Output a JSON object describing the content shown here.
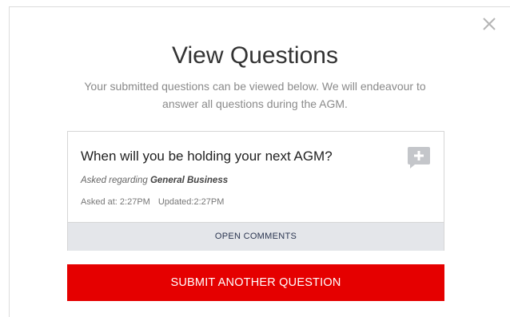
{
  "modal": {
    "title": "View Questions",
    "subtitle": "Your submitted questions can be viewed below. We will endeavour to answer all questions during the AGM."
  },
  "question": {
    "text": "When will you be holding your next AGM?",
    "regarding_prefix": "Asked regarding",
    "regarding_topic": "General Business",
    "asked_at": "Asked at: 2:27PM",
    "updated_at": "Updated:2:27PM",
    "open_comments_label": "OPEN COMMENTS"
  },
  "actions": {
    "submit_another_label": "SUBMIT ANOTHER QUESTION"
  },
  "colors": {
    "accent_red": "#e50000",
    "comments_bar": "#e4e6ea",
    "comment_icon": "#c4c6ca"
  },
  "icons": {
    "close": "close-icon",
    "add_comment": "add-comment-icon"
  }
}
